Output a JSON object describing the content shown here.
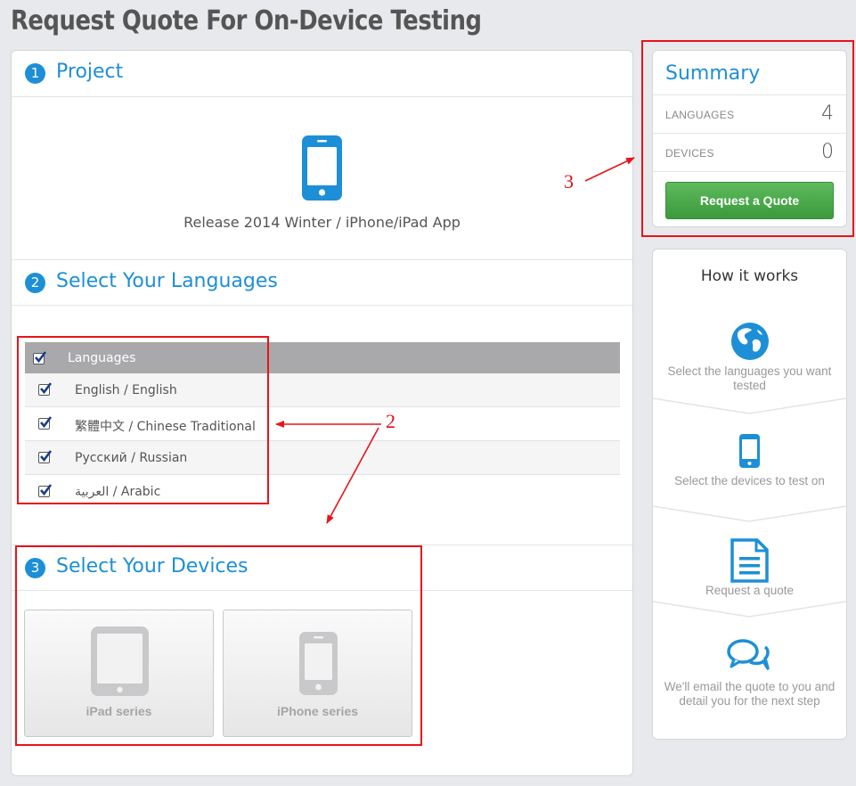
{
  "page": {
    "title": "Request Quote For On-Device Testing"
  },
  "project": {
    "step": "1",
    "heading": "Project",
    "name": "Release 2014 Winter / iPhone/iPad App"
  },
  "languages": {
    "step": "2",
    "heading": "Select Your Languages",
    "column_header": "Languages",
    "items": [
      {
        "label": "English / English",
        "checked": true
      },
      {
        "label": "繁體中文 / Chinese Traditional",
        "checked": true
      },
      {
        "label": "Русский / Russian",
        "checked": true
      },
      {
        "label": "العربية / Arabic",
        "checked": true
      }
    ]
  },
  "devices": {
    "step": "3",
    "heading": "Select Your Devices",
    "items": [
      {
        "label": "iPad series"
      },
      {
        "label": "iPhone series"
      }
    ]
  },
  "summary": {
    "title": "Summary",
    "languages_label": "LANGUAGES",
    "languages_value": "4",
    "devices_label": "DEVICES",
    "devices_value": "0",
    "button_label": "Request a Quote"
  },
  "how_it_works": {
    "title": "How it works",
    "steps": [
      {
        "icon": "globe-icon",
        "text": "Select the languages you want tested"
      },
      {
        "icon": "phone-icon",
        "text": "Select the devices to test on"
      },
      {
        "icon": "document-icon",
        "text": "Request a quote"
      },
      {
        "icon": "chat-bubbles-icon",
        "text": "We'll email the quote to you and detail you for the next step"
      }
    ]
  },
  "annotations": {
    "label_2": "2",
    "label_3": "3"
  },
  "colors": {
    "accent": "#1d8fd6",
    "button_green": "#4caf4c",
    "annotation_red": "#e8141a"
  }
}
